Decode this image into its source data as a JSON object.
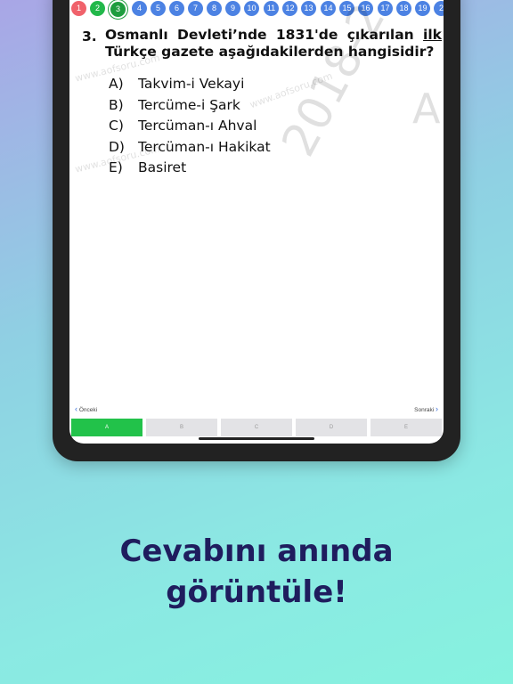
{
  "question_nav": [
    {
      "label": "1",
      "state": "wrong"
    },
    {
      "label": "2",
      "state": "correct"
    },
    {
      "label": "3",
      "state": "current"
    },
    {
      "label": "4",
      "state": "open"
    },
    {
      "label": "5",
      "state": "open"
    },
    {
      "label": "6",
      "state": "open"
    },
    {
      "label": "7",
      "state": "open"
    },
    {
      "label": "8",
      "state": "open"
    },
    {
      "label": "9",
      "state": "open"
    },
    {
      "label": "10",
      "state": "open"
    },
    {
      "label": "11",
      "state": "open"
    },
    {
      "label": "12",
      "state": "open"
    },
    {
      "label": "13",
      "state": "open"
    },
    {
      "label": "14",
      "state": "open"
    },
    {
      "label": "15",
      "state": "open"
    },
    {
      "label": "16",
      "state": "open"
    },
    {
      "label": "17",
      "state": "open"
    },
    {
      "label": "18",
      "state": "open"
    },
    {
      "label": "19",
      "state": "open"
    },
    {
      "label": "2",
      "state": "open"
    }
  ],
  "question": {
    "number": "3.",
    "line1_words": [
      "Osmanlı",
      "Devleti’nde",
      "1831'de",
      "çıkarılan"
    ],
    "line1_underlined": "ilk",
    "line2": "Türkçe gazete aşağıdakilerden hangisidir?"
  },
  "options": [
    {
      "letter": "A)",
      "text": "Takvim-i Vekayi"
    },
    {
      "letter": "B)",
      "text": "Tercüme-i Şark"
    },
    {
      "letter": "C)",
      "text": "Tercüman-ı Ahval"
    },
    {
      "letter": "D)",
      "text": "Tercüman-ı Hakikat"
    },
    {
      "letter": "E)",
      "text": "Basiret"
    }
  ],
  "watermark": {
    "site": "www.aofsoru.com",
    "year": "2018-2",
    "letter": "A"
  },
  "nav": {
    "prev_label": "Önceki",
    "next_label": "Sonraki",
    "prev_icon": "chevron-left-icon",
    "next_icon": "chevron-right-icon"
  },
  "answers": [
    {
      "label": "A",
      "selected": true
    },
    {
      "label": "B",
      "selected": false
    },
    {
      "label": "C",
      "selected": false
    },
    {
      "label": "D",
      "selected": false
    },
    {
      "label": "E",
      "selected": false
    }
  ],
  "tagline": {
    "line1": "Cevabını anında",
    "line2": "görüntüle!"
  },
  "colors": {
    "wrong": "#f0626b",
    "correct": "#22b84a",
    "open": "#4c82e3",
    "selected_answer": "#22c24a",
    "tagline": "#1f1d5e"
  }
}
